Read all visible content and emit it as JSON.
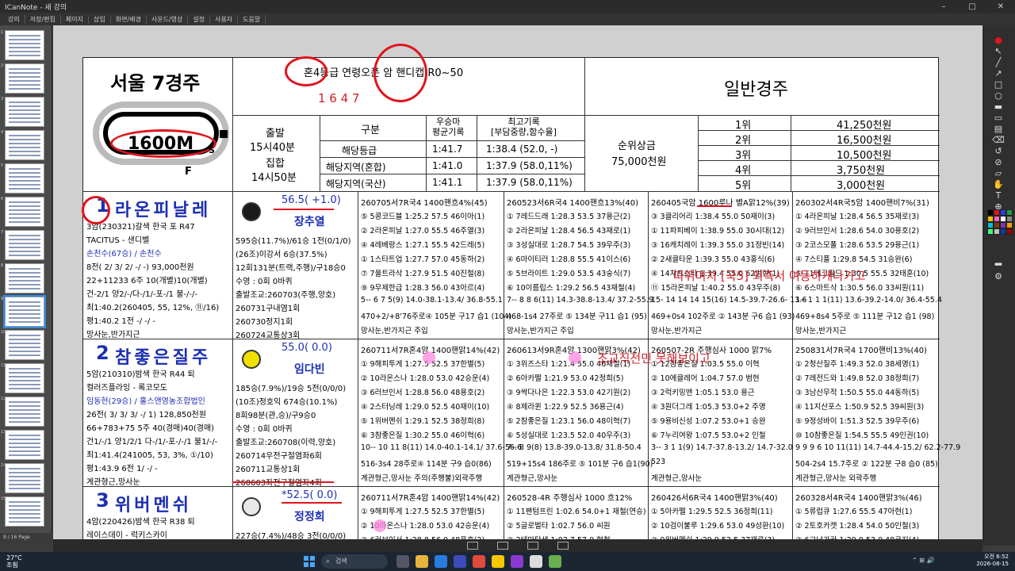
{
  "window": {
    "title": "ICanNote - 새 강의"
  },
  "menu": [
    "강의",
    "저장/편집",
    "페이지",
    "삽입",
    "화면/배경",
    "사운드/영상",
    "설정",
    "사용자",
    "도움말"
  ],
  "thumbnails": {
    "numbers": [
      "1",
      "2",
      "3",
      "4",
      "5",
      "6",
      "7",
      "8",
      "9",
      "10",
      "11",
      "12",
      "13",
      "14",
      "15",
      "16"
    ],
    "footer": "9 / 16 Page"
  },
  "race": {
    "venue": "서울 7경주",
    "distance": "1600M",
    "conditions": "혼4등급  연령오픈  암  핸디캡  R0~50",
    "handwritten": "1  6  4  7",
    "type": "일반경주",
    "start_label": "출발",
    "start_time": "15시40분",
    "gather_label": "집합",
    "gather_time": "14시50분",
    "record_headers": [
      "구분",
      "우승마\n평균기록",
      "최고기록\n[부담중량,함수율]"
    ],
    "records": [
      [
        "해당등급",
        "1:41.7",
        "1:38.4  (52.0,  -)"
      ],
      [
        "해당지역(혼합)",
        "1:41.0",
        "1:37.9  (58.0,11%)"
      ],
      [
        "해당지역(국산)",
        "1:41.1",
        "1:37.9  (58.0,11%)"
      ]
    ],
    "prize_label": "순위상금",
    "prize_total": "75,000천원",
    "prizes": [
      [
        "1위",
        "41,250천원"
      ],
      [
        "2위",
        "16,500천원"
      ],
      [
        "3위",
        "10,500천원"
      ],
      [
        "4위",
        "3,750천원"
      ],
      [
        "5위",
        "3,000천원"
      ]
    ]
  },
  "annotations": {
    "a1": "따뛰며치 [국5] 외측서 여등하게나가고",
    "a2": "조교직전민 못해보이고"
  },
  "horses": [
    {
      "num": "1",
      "name": "라온피날레",
      "weight": "56.5( +1.0)",
      "jockey": "장추열",
      "info": [
        "3암(230321)갈색 한국 포 R47",
        "TACITUS - 샌디벨",
        "손천수(67승) / 손천수",
        "8전( 2/ 3/ 2/ -/ -)   93,000천원",
        "22+11233 6주 10(개별)10(개별)",
        "건-2/1 양2/-/다-/1/-포-/1 불-/-/-",
        "최1:40.2(260405, 55, 12%, ⑪/16)",
        "평1:40.2     1전  -/  -/  -",
        "망사눈,반가지근"
      ],
      "stats": [
        "595승(11.7%)/61승   1전(0/1/0)",
        "(26조)이강서 6승(37.5%)",
        "12회131분(트랙,주행)/구18승0",
        "수영 : 0회 0바퀴",
        "출발조교:260703(주행,양호)",
        "260731구내염1회",
        "260730정지1회",
        "260724교통상3회"
      ],
      "races": [
        {
          "head": "260705서7R국4 1400핸흐4%(45)",
          "rows": [
            "⑤ 5콩코드블 1:25.2  57.5 46이아(1)",
            "② 2라온피날 1:27.0  55.5 46주열(3)",
            "④ 4레베랑스 1:27.1  55.5 42드레(5)",
            "① 1스타트업 1:27.7  57.0 45동하(2)",
            "⑦ 7울트라삭 1:27.9  51.5 40진철(8)",
            "⑨ 9무제한급 1:28.3  56.0 43아르(4)",
            "5-- 6 7 5(9) 14.0-38.1-13.4/ 36.8-55.1",
            "470+2/+8'76주로④ 105분 구17 습1 (104)",
            "망사눈,반가지근 주입"
          ]
        },
        {
          "head": "260523서6R국4 1400핸흐13%(40)",
          "rows": [
            "① 7레드드래 1:28.3  53.5 37용근(2)",
            "② 2라온피날 1:28.4  56.5 43재로(1)",
            "③ 3성실대로 1:28.7  54.5 39우주(3)",
            "④ 6마이티러 1:28.8  55.5 41이스(6)",
            "⑤ 5브라이트 1:29.0  53.5 43숭식(7)",
            "⑥ 10이름립스 1:29.2  56.5 43재철(4)",
            "7-- 8 8 6(11) 14.3-38.8-13.4/ 37.2-55.9",
            "468-1s4 27주로 ⑤ 134분 구11 습1 (95)",
            "망사눈,반가지근 주입"
          ]
        },
        {
          "head": "260405국암 1600루나 별A맑12%(39)",
          "rows": [
            "③ 3클리어리 1:38.4  55.0 50재이(3)",
            "① 11파피베이 1:38.9  55.0 30시대(12)",
            "③ 16캐치레이 1:39.3  55.0 31정빈(14)",
            "② 2새클타운 1:39.3  55.0 43홍식(6)",
            "④ 14치프스타 1:39.4  55.0 62범현(1)",
            "⑪ 15라온피날 1:40.2  55.0 43우주(8)",
            "15- 14 14 14 15(16) 14.5-39.7-26.6- 13.6",
            "469+0s4 102주로 ② 143분 구6 습1 (93)",
            "망사눈,반가지근"
          ]
        },
        {
          "head": "260302서4R국5암 1400핸비7%(31)",
          "rows": [
            "① 4라온피날 1:28.4  56.5 35재로(3)",
            "② 9러브인서 1:28.6  54.0 30용호(2)",
            "③ 2코스모폴 1:28.6  53.5 29용근(1)",
            "④ 7스티플 1:29.8  54.5 31승완(6)",
            "⑤ 11에코윌드 1:30.5  55.5 32태훈(10)",
            "⑥ 6스마트삭 1:30.5  56.0 33씨원(11)",
            "1-- 1 1 1(11) 13.6-39.2-14.0/ 36.4-55.4",
            "469+8s4 5주로 ⑤ 111분 구12 습1 (98)",
            "망사눈,반가지근"
          ]
        }
      ]
    },
    {
      "num": "2",
      "name": "참좋은질주",
      "weight": "55.0(  0.0)",
      "jockey": "임다빈",
      "info": [
        "5암(210310)밤색 한국 R44 퇴",
        "컬러즈플라잉 - 록코모도",
        "임동현(29승) / 홀스앤영농조합법인",
        "26전( 3/ 3/ 3/ -/ 1)   128,850천원",
        "66+783+75 5주 40(경매)40(경매)",
        "건1/-/1 양1/2/1 다-/1/-포-/-/1 불1/-/-",
        "최1:41.4(241005, 53, 3%, ①/10)",
        "평1:43.9     6전  1/  -/  -",
        "계관형근,망사눈"
      ],
      "stats": [
        "185승(7.9%)/19승   5전(0/0/0)",
        "(10조)정호익 674승(10.1%)",
        "8회98분(관,승)/구9승0",
        "수영 : 0회 0바퀴",
        "출발조교:260708(이력,양호)",
        "260714우전구절염좌6회",
        "260711교통상1회",
        "260603좌전구절염좌4회"
      ],
      "races": [
        {
          "head": "260711서7R혼4암 1400핸맑14%(42)",
          "rows": [
            "① 9해피투게 1:27.5  52.5 37한별(5)",
            "② 10라온스나 1:28.0  53.0 42승운(4)",
            "③ 6러브인서 1:28.8  56.0 48용호(2)",
            "④ 2스터닝레 1:29.0  52.5 40재이(10)",
            "⑤ 1위버멘쉬 1:29.1  52.5 38정희(8)",
            "⑥ 3참좋은질 1:30.2  55.0 46이혁(6)",
            "10-- 10 11 8(11) 14.0-40.1-14.1/ 37.6-56.6",
            "516-3s4 28주로④ 114분 구9 습0(86)",
            "계관형근,망사눈 주의(주행불)외곽주행"
          ]
        },
        {
          "head": "260613서9R혼4암 1300핸맑3%(42)",
          "rows": [
            "① 3위즈스타 1:21.4  55.0 46채철(1)",
            "② 6아카펠 1:21.9  53.0 42정희(5)",
            "③ 9싹다나은 1:22.3  53.0 42기원(2)",
            "④ 8제라퀸 1:22.9  52.5 36용근(4)",
            "⑤ 2참좋은질 1:23.1  56.0 48이혁(7)",
            "⑥ 5성실대로 1:23.5  52.0 40우주(3)",
            "7-- 8 9(8) 13.8-39.0-13.8/ 31.8-50.4",
            "519+15s4 186주로 ⑤ 101분 구6 습1(90)",
            "계관형근,망사눈"
          ]
        },
        {
          "head": "260507-2R 주행심사 1000 맑7%",
          "rows": [
            "① 12참좋은질 1:03.5  55.0 이혁",
            "② 10에클레어 1:04.7  57.0 범현",
            "③ 2럭키밍맨 1:05.1  53.0 용근",
            "④ 3원더그레 1:05.3  53.0+2 주영",
            "⑤ 9용비신성 1:07.2  53.0+1 승완",
            "⑥ 7누리여왕 1:07.5  53.0+2 인철",
            "3-- 3 1 1(9) 14.7-37.8-13.2/ 14.7-32.0",
            "523",
            "계관형근,망사눈"
          ]
        },
        {
          "head": "250831서7R국4 1700핸비13%(40)",
          "rows": [
            "① 2청산질주 1:49.3  52.0 38세영(1)",
            "② 7레전드와 1:49.8  52.0 38정희(7)",
            "③ 3남산무적 1:50.5  55.0 44동하(5)",
            "④ 11지산포스 1:50.9  52.5 39씨원(3)",
            "⑤ 9정성바이 1:51.3  52.5 39우주(6)",
            "⑩ 10참좋은질 1:54.5  55.5 49인권(10)",
            "9 9 9 6 10 11(11) 14.7-44.4-15.2/ 62.2-77.9",
            "504-2s4 15.7주로 ② 122분 구8 습0 (85)",
            "계관형근,망사눈 외곽주행"
          ]
        }
      ]
    },
    {
      "num": "3",
      "name": "위버멘쉬",
      "weight": "*52.5(  0.0)",
      "jockey": "정정희",
      "info": [
        "4암(220426)밤색 한국 R38 퇴",
        "레이스데이 - 럭키스카이",
        "오종택(70승) / 김재석"
      ],
      "stats": [
        "227승(7.4%)/48승   3전(0/0/0)",
        "(51조)최용걸 172승(10.6%)"
      ],
      "races": [
        {
          "head": "260711서7R혼4암 1400핸맑14%(42)",
          "rows": [
            "① 9해피투게 1:27.5  52.5 37한별(5)",
            "② 10라온스나 1:28.0  53.0 42승운(4)",
            "③ 6러브인서 1:28.8  56.0 48용호(2)"
          ]
        },
        {
          "head": "260528-4R 주행심사 1000 흐12%",
          "rows": [
            "① 11팬텀프린 1:02.6  54.0+1 재철(연승)",
            "② 5글로벌타 1:02.7  56.0 씨원",
            "③ 2테마탄생 1:02.7  57.0 형철"
          ]
        },
        {
          "head": "260426서6R국4 1400핸맑3%(40)",
          "rows": [
            "① 5아카펠 1:29.5  52.5 36정희(11)",
            "② 10검이불루 1:29.6  53.0 49성환(10)",
            "③ 9위버멘쉬 1:29.9  52.5 37재로(3)"
          ]
        },
        {
          "head": "260328서4R국4 1400핸맑3%(46)",
          "rows": [
            "① 5류럽큐 1:27.6  55.5 47아현(1)",
            "② 2토호카캣 1:28.4  54.0 50인철(3)",
            "③ 6그낭가라 1:29.9  53.0 48코지(4)"
          ]
        }
      ]
    }
  ],
  "taskbar": {
    "temp": "27°C",
    "weather": "조흼",
    "search": "검색",
    "time": "오전 6:52",
    "date": "2026-08-15"
  }
}
